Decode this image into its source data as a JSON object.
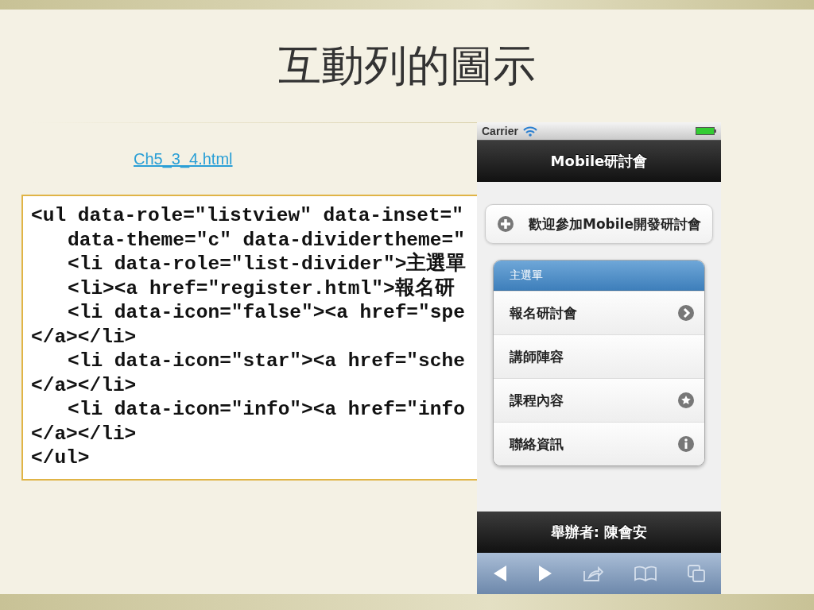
{
  "slide": {
    "title": "互動列的圖示",
    "link": "Ch5_3_4.html",
    "code_lines": [
      {
        "text": "<ul data-role=\"listview\" data-inset=\"",
        "kind": "flush"
      },
      {
        "text": "data-theme=\"c\" data-dividertheme=\"",
        "kind": "indented"
      },
      {
        "text": "<li data-role=\"list-divider\">主選單",
        "kind": "indented"
      },
      {
        "text": "<li><a href=\"register.html\">報名研",
        "kind": "indented"
      },
      {
        "text": "<li data-icon=\"false\"><a href=\"spe",
        "kind": "indented"
      },
      {
        "text": "</a></li>",
        "kind": "flush"
      },
      {
        "text": "<li data-icon=\"star\"><a href=\"sche",
        "kind": "indented"
      },
      {
        "text": "</a></li>",
        "kind": "flush"
      },
      {
        "text": "<li data-icon=\"info\"><a href=\"info",
        "kind": "indented"
      },
      {
        "text": "</a></li>",
        "kind": "flush"
      },
      {
        "text": "</ul>",
        "kind": "flush"
      }
    ]
  },
  "phone": {
    "carrier": "Carrier",
    "header": "Mobile研討會",
    "welcome_button": "歡迎參加Mobile開發研討會",
    "list": {
      "divider": "主選單",
      "items": [
        {
          "label": "報名研討會",
          "kind": "arrow"
        },
        {
          "label": "講師陣容",
          "kind": "plain"
        },
        {
          "label": "課程內容",
          "kind": "star"
        },
        {
          "label": "聯絡資訊",
          "kind": "info"
        }
      ]
    },
    "footer": "舉辦者: 陳會安"
  }
}
